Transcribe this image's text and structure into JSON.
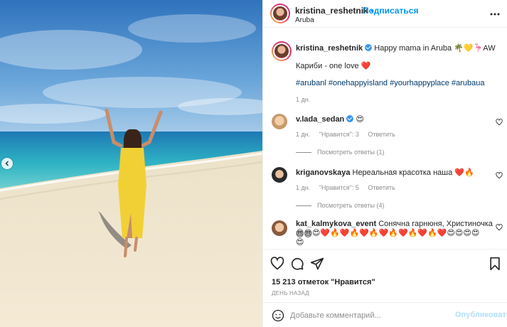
{
  "photo": {
    "alt": "woman in yellow dress on beach",
    "nav": "chevron-left-icon"
  },
  "header": {
    "username": "kristina_reshetnik",
    "dot": "•",
    "follow": "Подписаться",
    "location": "Aruba",
    "more_icon": "more-horizontal-icon"
  },
  "caption": {
    "username": "kristina_reshetnik",
    "text": "Happy mama in Aruba 🌴💛🦩AW",
    "line2": "Кариби - one love ❤️",
    "hashtags": "#arubanl #onehappyisland #yourhappyplace #arubaua",
    "time": "1 дн."
  },
  "comments": [
    {
      "username": "v.lada_sedan",
      "text": "😍",
      "time": "1 дн.",
      "likes": "\"Нравится\": 3",
      "reply": "Ответить",
      "replies": "Посмотреть ответы (1)"
    },
    {
      "username": "kriganovskaya",
      "text": "Нереальная красотка наша ❤️🔥",
      "time": "1 дн.",
      "likes": "\"Нравится\": 5",
      "reply": "Ответить",
      "replies": "Посмотреть ответы (4)"
    },
    {
      "username": "kat_kalmykova_event",
      "text": "Сонячна гарнюня, Христиночка😍😍",
      "line2": "😍😍😍❤️🔥❤️🔥❤️🔥❤️🔥❤️🔥❤️🔥❤️😍😍😍😍",
      "line3": "😍"
    }
  ],
  "actions": {
    "likes": "15 213 отметок \"Нравится\"",
    "ago": "ДЕНЬ НАЗАД",
    "comment_placeholder": "Добавьте комментарий...",
    "publish": "Опубликовать"
  },
  "colors": {
    "link": "#0095f6",
    "hashtag": "#00376b",
    "muted": "#8e8e8e",
    "dress": "#f1d035"
  }
}
